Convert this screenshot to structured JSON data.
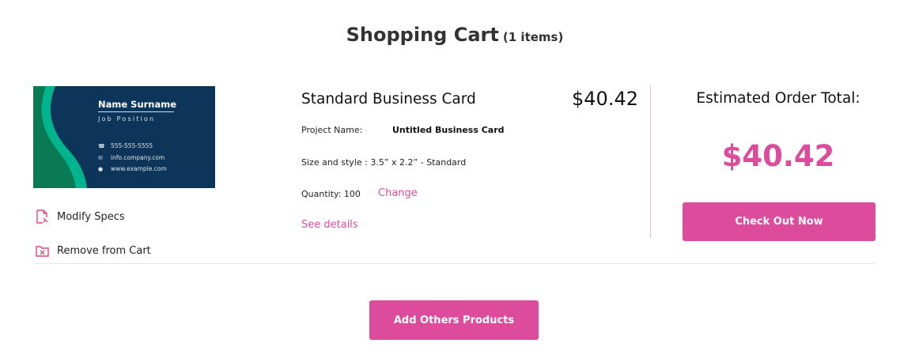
{
  "header": {
    "title": "Shopping Cart",
    "item_count": "(1 items)"
  },
  "card_preview": {
    "name": "Name Surname",
    "job": "Job Position",
    "phone": "555-555-5555",
    "email": "info.company.com",
    "web": "www.example.com",
    "colors": {
      "background": "#0d3559",
      "accent_light": "#00b58d",
      "accent_dark": "#0a7a55"
    }
  },
  "actions": {
    "modify": "Modify Specs",
    "remove": "Remove from Cart"
  },
  "product": {
    "title": "Standard Business Card",
    "price": "$40.42",
    "project_label": "Project Name:",
    "project_value": "Untitled Business Card",
    "size_style": "Size and style : 3.5” x 2.2” - Standard",
    "quantity": "Quantity: 100",
    "change_link": "Change",
    "details_link": "See details"
  },
  "summary": {
    "label": "Estimated Order Total:",
    "total": "$40.42",
    "checkout_label": "Check Out Now"
  },
  "footer": {
    "add_products_label": "Add Others Products"
  },
  "colors": {
    "accent": "#dd4c9c",
    "divider": "#e2b9cf"
  }
}
